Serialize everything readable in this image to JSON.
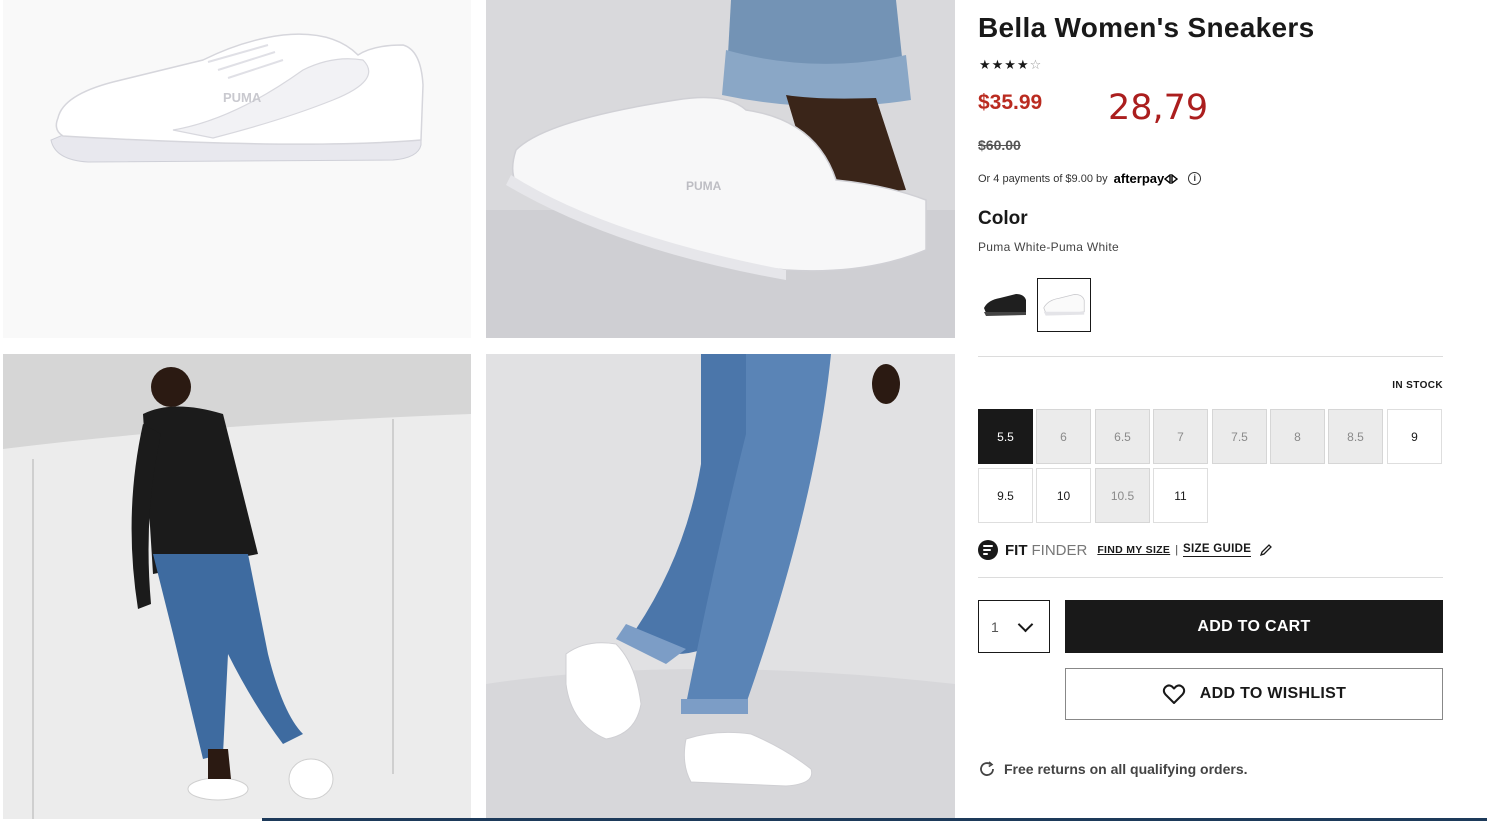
{
  "product": {
    "title": "Bella Women's Sneakers",
    "rating_stars_filled": "★★★★",
    "rating_stars_empty": "☆",
    "sale_price": "$35.99",
    "alt_price": "28,79",
    "original_price": "$60.00",
    "afterpay_text": "Or 4 payments of $9.00 by",
    "afterpay_brand": "afterpay",
    "afterpay_info": "i"
  },
  "color": {
    "heading": "Color",
    "value": "Puma White-Puma White"
  },
  "sizes": {
    "stock_label": "IN STOCK",
    "options": [
      {
        "label": "5.5",
        "state": "selected"
      },
      {
        "label": "6",
        "state": "unavailable"
      },
      {
        "label": "6.5",
        "state": "unavailable"
      },
      {
        "label": "7",
        "state": "unavailable"
      },
      {
        "label": "7.5",
        "state": "unavailable"
      },
      {
        "label": "8",
        "state": "unavailable"
      },
      {
        "label": "8.5",
        "state": "unavailable"
      },
      {
        "label": "9",
        "state": "available"
      },
      {
        "label": "9.5",
        "state": "available"
      },
      {
        "label": "10",
        "state": "available"
      },
      {
        "label": "10.5",
        "state": "unavailable"
      },
      {
        "label": "11",
        "state": "available"
      }
    ]
  },
  "fit_finder": {
    "fit": "FIT",
    "finder": "FINDER",
    "find_my_size": "FIND MY SIZE",
    "separator": "|",
    "size_guide": "SIZE GUIDE"
  },
  "cart": {
    "quantity": "1",
    "add_to_cart": "ADD TO CART",
    "add_to_wishlist": "ADD TO WISHLIST"
  },
  "returns": {
    "text": "Free returns on all qualifying orders."
  },
  "colors": {
    "sale_red": "#ba2b20",
    "primary_dark": "#191919"
  },
  "icons": {
    "rating": "star-icon",
    "info": "info-icon",
    "quantity": "chevron-down-icon",
    "wishlist": "heart-icon",
    "size_guide": "pencil-icon",
    "returns": "refresh-icon"
  }
}
